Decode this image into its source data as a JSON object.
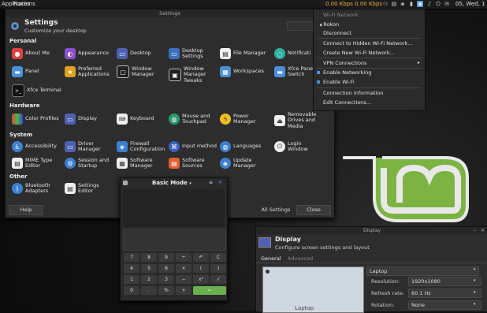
{
  "panel": {
    "apps": "Applications",
    "places": "Places",
    "speed": "0.00 Kbps 0.00 Kbps",
    "clock": "05, Wed, 1"
  },
  "settings": {
    "window_title": "Settings",
    "title": "Settings",
    "subtitle": "Customize your desktop",
    "sections": {
      "personal": "Personal",
      "hardware": "Hardware",
      "system": "System",
      "other": "Other"
    },
    "items": {
      "about": "About Me",
      "appearance": "Appearance",
      "desktop": "Desktop",
      "desktop_settings": "Desktop Settings",
      "file_manager": "File Manager",
      "notifications": "Notificati",
      "panel": "Panel",
      "preferred_apps": "Preferred Applications",
      "window_manager": "Window Manager",
      "wm_tweaks": "Window Manager Tweaks",
      "workspaces": "Workspaces",
      "xfce_panel_switch": "Xfce Panel Switch",
      "xfce_terminal": "Xfce Terminal",
      "color_profiles": "Color Profiles",
      "display": "Display",
      "keyboard": "Keyboard",
      "mouse": "Mouse and Touchpad",
      "power": "Power Manager",
      "removable": "Removable Drives and Media",
      "accessibility": "Accessibility",
      "driver_manager": "Driver Manager",
      "firewall": "Firewall Configuration",
      "input_method": "Input method",
      "languages": "Languages",
      "login_window": "Login Window",
      "mime": "MIME Type Editor",
      "session": "Session and Startup",
      "software_manager": "Software Manager",
      "software_sources": "Software Sources",
      "update_manager": "Update Manager",
      "bluetooth": "Bluetooth Adapters",
      "settings_editor": "Settings Editor"
    },
    "help_btn": "Help",
    "all_settings_btn": "All Settings",
    "close_btn": "Close"
  },
  "wifi_menu": {
    "header": "Wi-Fi Network",
    "network": "Rokon",
    "disconnect": "Disconnect",
    "hidden": "Connect to Hidden Wi-Fi Network...",
    "create_new": "Create New Wi-Fi Network...",
    "vpn": "VPN Connections",
    "enable_networking": "Enable Networking",
    "enable_wifi": "Enable Wi-Fi",
    "conn_info": "Connection Information",
    "edit_conn": "Edit Connections..."
  },
  "calculator": {
    "mode": "Basic Mode",
    "keys": [
      "7",
      "8",
      "9",
      "÷",
      "↶",
      "C",
      "4",
      "5",
      "6",
      "×",
      "(",
      ")",
      "1",
      "2",
      "3",
      "−",
      "x²",
      "√",
      "0",
      ".",
      "%",
      "+",
      "="
    ]
  },
  "display_window": {
    "window_title": "Display",
    "title": "Display",
    "subtitle": "Configure screen settings and layout",
    "tab_general": "General",
    "tab_advanced": "Advanced",
    "monitor": "Laptop",
    "resolution_label": "Resolution:",
    "resolution": "1920x1080",
    "refresh_label": "Refresh rate:",
    "refresh": "60.1 Hz",
    "rotation_label": "Rotation:",
    "rotation": "None",
    "preview_label": "Laptop"
  },
  "colors": {
    "accent": "#4a90d9",
    "mint_green": "#8bc34a",
    "calc_equals": "#6ab04c"
  }
}
